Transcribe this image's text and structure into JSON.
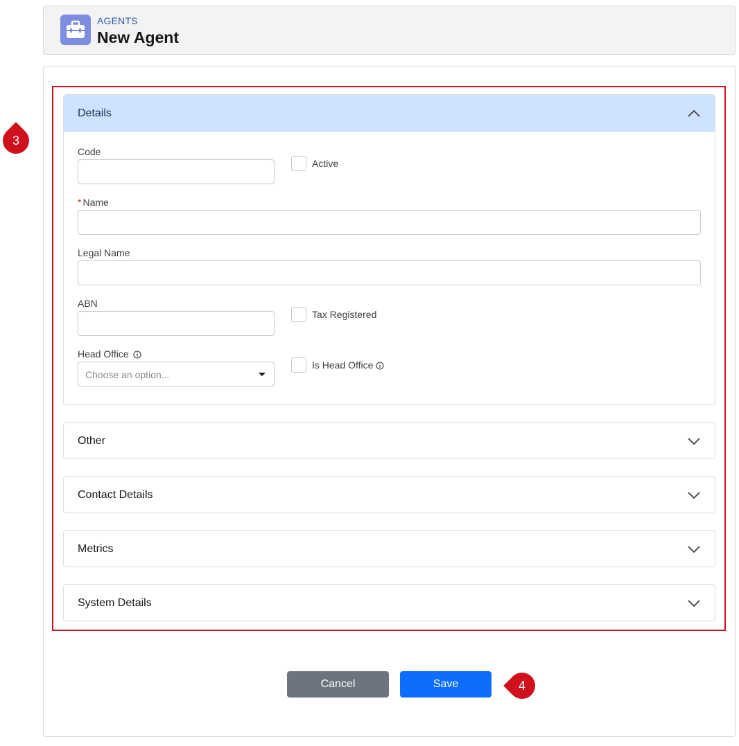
{
  "header": {
    "eyebrow": "AGENTS",
    "title": "New Agent",
    "icon": "briefcase-icon"
  },
  "sections": {
    "details": {
      "label": "Details",
      "expanded": true
    },
    "other": {
      "label": "Other",
      "expanded": false
    },
    "contact": {
      "label": "Contact Details",
      "expanded": false
    },
    "metrics": {
      "label": "Metrics",
      "expanded": false
    },
    "system": {
      "label": "System Details",
      "expanded": false
    }
  },
  "fields": {
    "code": {
      "label": "Code",
      "value": ""
    },
    "active": {
      "label": "Active",
      "checked": false
    },
    "name": {
      "label": "Name",
      "required_marker": "*",
      "value": ""
    },
    "legal_name": {
      "label": "Legal Name",
      "value": ""
    },
    "abn": {
      "label": "ABN",
      "value": ""
    },
    "tax_registered": {
      "label": "Tax Registered",
      "checked": false
    },
    "head_office": {
      "label": "Head Office",
      "placeholder": "Choose an option..."
    },
    "is_head_office": {
      "label": "Is Head Office",
      "checked": false
    }
  },
  "buttons": {
    "cancel": "Cancel",
    "save": "Save"
  },
  "callouts": {
    "step_3": "3",
    "step_4": "4"
  },
  "colors": {
    "highlight": "#d0101c",
    "open_section_bg": "#cfe2ff",
    "save": "#0d6efd",
    "cancel": "#6c757d",
    "app_icon": "#7f8de1"
  }
}
